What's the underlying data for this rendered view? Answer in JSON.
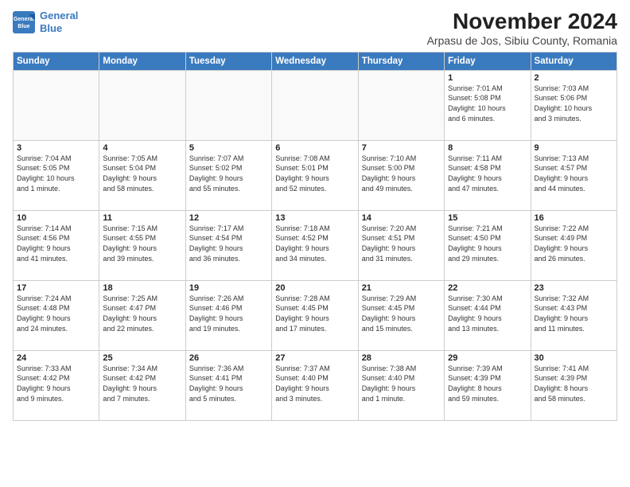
{
  "header": {
    "logo_line1": "General",
    "logo_line2": "Blue",
    "title": "November 2024",
    "subtitle": "Arpasu de Jos, Sibiu County, Romania"
  },
  "weekdays": [
    "Sunday",
    "Monday",
    "Tuesday",
    "Wednesday",
    "Thursday",
    "Friday",
    "Saturday"
  ],
  "weeks": [
    [
      {
        "day": "",
        "info": ""
      },
      {
        "day": "",
        "info": ""
      },
      {
        "day": "",
        "info": ""
      },
      {
        "day": "",
        "info": ""
      },
      {
        "day": "",
        "info": ""
      },
      {
        "day": "1",
        "info": "Sunrise: 7:01 AM\nSunset: 5:08 PM\nDaylight: 10 hours\nand 6 minutes."
      },
      {
        "day": "2",
        "info": "Sunrise: 7:03 AM\nSunset: 5:06 PM\nDaylight: 10 hours\nand 3 minutes."
      }
    ],
    [
      {
        "day": "3",
        "info": "Sunrise: 7:04 AM\nSunset: 5:05 PM\nDaylight: 10 hours\nand 1 minute."
      },
      {
        "day": "4",
        "info": "Sunrise: 7:05 AM\nSunset: 5:04 PM\nDaylight: 9 hours\nand 58 minutes."
      },
      {
        "day": "5",
        "info": "Sunrise: 7:07 AM\nSunset: 5:02 PM\nDaylight: 9 hours\nand 55 minutes."
      },
      {
        "day": "6",
        "info": "Sunrise: 7:08 AM\nSunset: 5:01 PM\nDaylight: 9 hours\nand 52 minutes."
      },
      {
        "day": "7",
        "info": "Sunrise: 7:10 AM\nSunset: 5:00 PM\nDaylight: 9 hours\nand 49 minutes."
      },
      {
        "day": "8",
        "info": "Sunrise: 7:11 AM\nSunset: 4:58 PM\nDaylight: 9 hours\nand 47 minutes."
      },
      {
        "day": "9",
        "info": "Sunrise: 7:13 AM\nSunset: 4:57 PM\nDaylight: 9 hours\nand 44 minutes."
      }
    ],
    [
      {
        "day": "10",
        "info": "Sunrise: 7:14 AM\nSunset: 4:56 PM\nDaylight: 9 hours\nand 41 minutes."
      },
      {
        "day": "11",
        "info": "Sunrise: 7:15 AM\nSunset: 4:55 PM\nDaylight: 9 hours\nand 39 minutes."
      },
      {
        "day": "12",
        "info": "Sunrise: 7:17 AM\nSunset: 4:54 PM\nDaylight: 9 hours\nand 36 minutes."
      },
      {
        "day": "13",
        "info": "Sunrise: 7:18 AM\nSunset: 4:52 PM\nDaylight: 9 hours\nand 34 minutes."
      },
      {
        "day": "14",
        "info": "Sunrise: 7:20 AM\nSunset: 4:51 PM\nDaylight: 9 hours\nand 31 minutes."
      },
      {
        "day": "15",
        "info": "Sunrise: 7:21 AM\nSunset: 4:50 PM\nDaylight: 9 hours\nand 29 minutes."
      },
      {
        "day": "16",
        "info": "Sunrise: 7:22 AM\nSunset: 4:49 PM\nDaylight: 9 hours\nand 26 minutes."
      }
    ],
    [
      {
        "day": "17",
        "info": "Sunrise: 7:24 AM\nSunset: 4:48 PM\nDaylight: 9 hours\nand 24 minutes."
      },
      {
        "day": "18",
        "info": "Sunrise: 7:25 AM\nSunset: 4:47 PM\nDaylight: 9 hours\nand 22 minutes."
      },
      {
        "day": "19",
        "info": "Sunrise: 7:26 AM\nSunset: 4:46 PM\nDaylight: 9 hours\nand 19 minutes."
      },
      {
        "day": "20",
        "info": "Sunrise: 7:28 AM\nSunset: 4:45 PM\nDaylight: 9 hours\nand 17 minutes."
      },
      {
        "day": "21",
        "info": "Sunrise: 7:29 AM\nSunset: 4:45 PM\nDaylight: 9 hours\nand 15 minutes."
      },
      {
        "day": "22",
        "info": "Sunrise: 7:30 AM\nSunset: 4:44 PM\nDaylight: 9 hours\nand 13 minutes."
      },
      {
        "day": "23",
        "info": "Sunrise: 7:32 AM\nSunset: 4:43 PM\nDaylight: 9 hours\nand 11 minutes."
      }
    ],
    [
      {
        "day": "24",
        "info": "Sunrise: 7:33 AM\nSunset: 4:42 PM\nDaylight: 9 hours\nand 9 minutes."
      },
      {
        "day": "25",
        "info": "Sunrise: 7:34 AM\nSunset: 4:42 PM\nDaylight: 9 hours\nand 7 minutes."
      },
      {
        "day": "26",
        "info": "Sunrise: 7:36 AM\nSunset: 4:41 PM\nDaylight: 9 hours\nand 5 minutes."
      },
      {
        "day": "27",
        "info": "Sunrise: 7:37 AM\nSunset: 4:40 PM\nDaylight: 9 hours\nand 3 minutes."
      },
      {
        "day": "28",
        "info": "Sunrise: 7:38 AM\nSunset: 4:40 PM\nDaylight: 9 hours\nand 1 minute."
      },
      {
        "day": "29",
        "info": "Sunrise: 7:39 AM\nSunset: 4:39 PM\nDaylight: 8 hours\nand 59 minutes."
      },
      {
        "day": "30",
        "info": "Sunrise: 7:41 AM\nSunset: 4:39 PM\nDaylight: 8 hours\nand 58 minutes."
      }
    ]
  ]
}
